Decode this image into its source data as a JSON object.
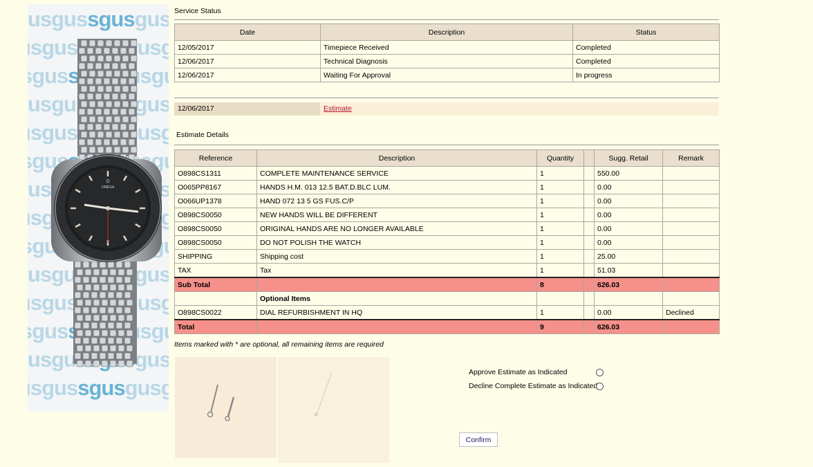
{
  "watermark": {
    "text_light": "gus",
    "text_dark": "sgus"
  },
  "service_status": {
    "title": "Service Status",
    "headers": [
      "Date",
      "Description",
      "Status"
    ],
    "rows": [
      {
        "date": "12/05/2017",
        "description": "Timepiece Received",
        "status": "Completed"
      },
      {
        "date": "12/06/2017",
        "description": "Technical Diagnosis",
        "status": "Completed"
      },
      {
        "date": "12/06/2017",
        "description": "Waiting For Approval",
        "status": "In progress"
      }
    ]
  },
  "estimate_link": {
    "date": "12/06/2017",
    "label": "Estimate"
  },
  "estimate_details": {
    "title": "Estimate Details",
    "headers": [
      "Reference",
      "Description",
      "Quantity",
      "",
      "Sugg. Retail",
      "Remark"
    ],
    "rows": [
      {
        "reference": "O898CS1311",
        "description": "COMPLETE MAINTENANCE SERVICE",
        "quantity": "1",
        "retail": "550.00",
        "remark": ""
      },
      {
        "reference": "O065PP8167",
        "description": "HANDS H.M. 013 12.5 BAT.D.BLC LUM.",
        "quantity": "1",
        "retail": "0.00",
        "remark": ""
      },
      {
        "reference": "O066UP1378",
        "description": "HAND 072 13 5 GS FUS.C/P",
        "quantity": "1",
        "retail": "0.00",
        "remark": ""
      },
      {
        "reference": "O898CS0050",
        "description": "NEW HANDS WILL BE DIFFERENT",
        "quantity": "1",
        "retail": "0.00",
        "remark": ""
      },
      {
        "reference": "O898CS0050",
        "description": "ORIGINAL HANDS ARE NO LONGER AVAILABLE",
        "quantity": "1",
        "retail": "0.00",
        "remark": ""
      },
      {
        "reference": "O898CS0050",
        "description": "DO NOT POLISH THE WATCH",
        "quantity": "1",
        "retail": "0.00",
        "remark": ""
      },
      {
        "reference": "SHIPPING",
        "description": "Shipping cost",
        "quantity": "1",
        "retail": "25.00",
        "remark": ""
      },
      {
        "reference": "TAX",
        "description": "Tax",
        "quantity": "1",
        "retail": "51.03",
        "remark": ""
      }
    ],
    "subtotal": {
      "label": "Sub Total",
      "quantity": "8",
      "retail": "626.03"
    },
    "optional_header": "Optional Items",
    "optional_rows": [
      {
        "reference": "O898CS0022",
        "description": "DIAL REFURBISHMENT IN HQ",
        "quantity": "1",
        "retail": "0.00",
        "remark": "Declined"
      }
    ],
    "total": {
      "label": "Total",
      "quantity": "9",
      "retail": "626.03"
    },
    "note": "Items marked with * are optional, all remaining items are required"
  },
  "approval": {
    "approve_label": "Approve Estimate as Indicated",
    "decline_label": "Decline Complete Estimate as Indicated",
    "confirm_label": "Confirm"
  },
  "colors": {
    "background": "#fefde8",
    "header": "#e9dfcc",
    "subtotal": "#f6908a",
    "link": "#b0142d"
  }
}
